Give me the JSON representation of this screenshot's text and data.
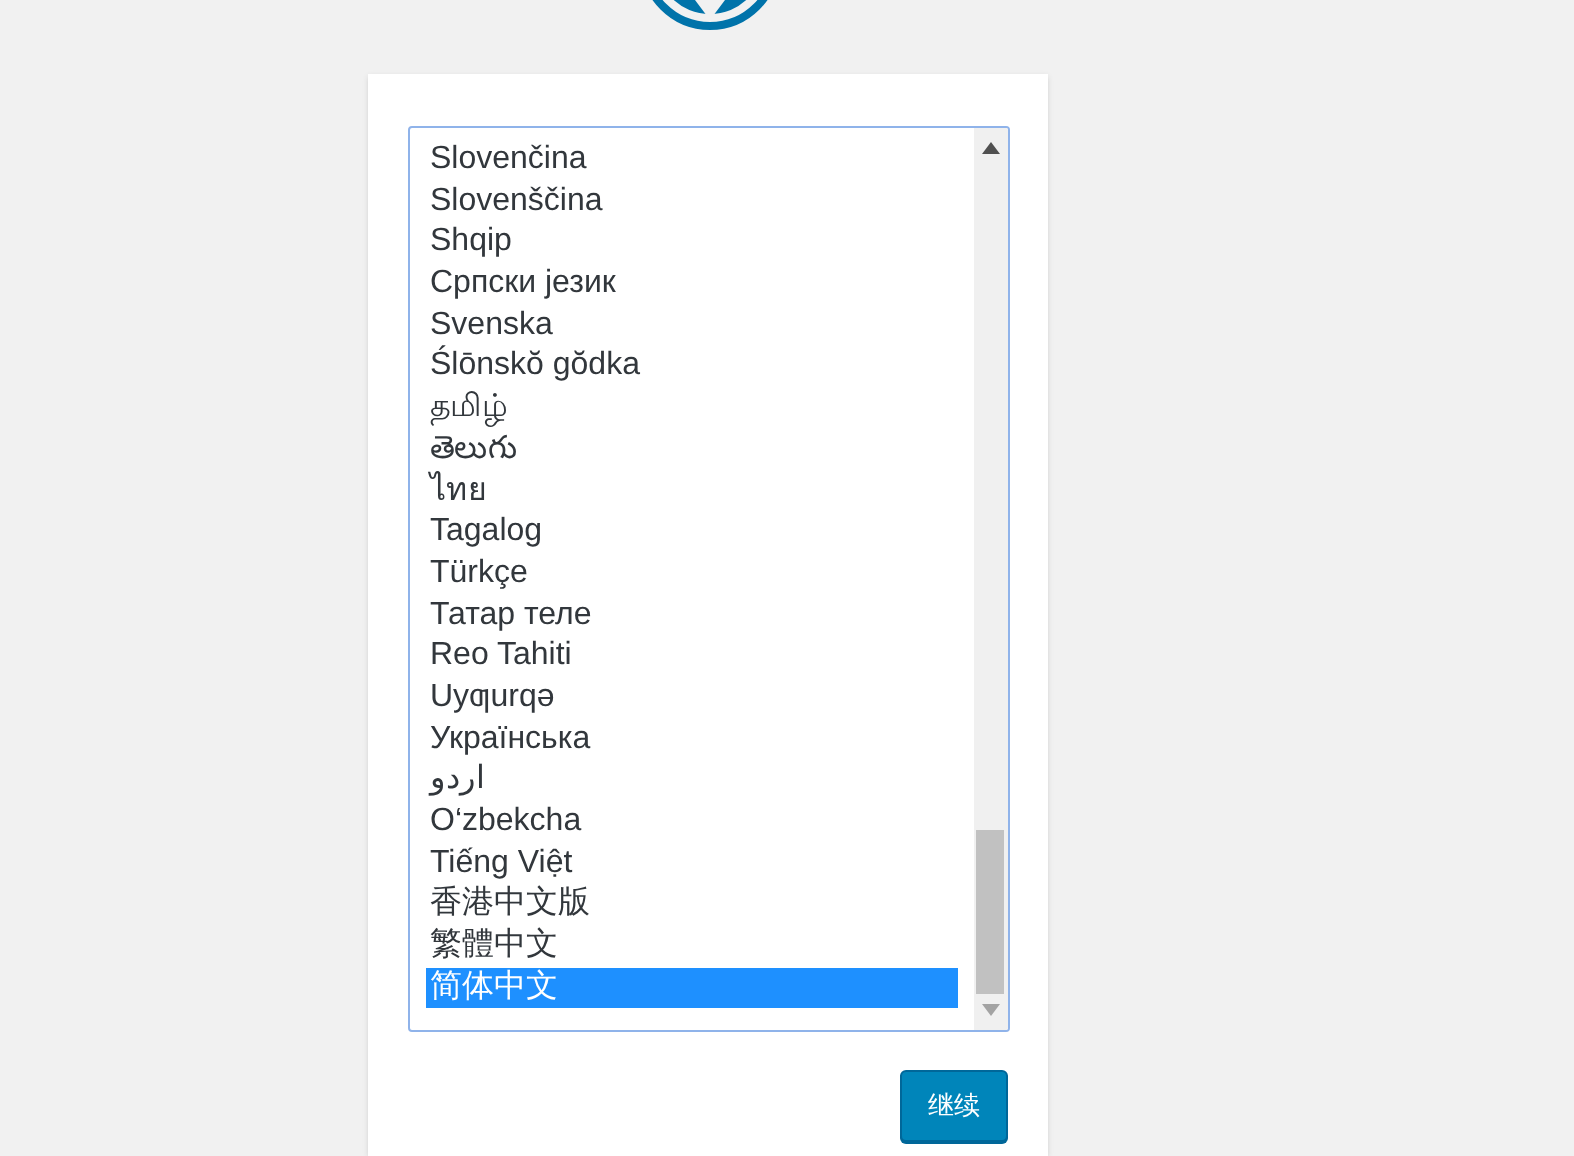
{
  "language_list": {
    "items": [
      {
        "label": "Slovenčina",
        "selected": false
      },
      {
        "label": "Slovenščina",
        "selected": false
      },
      {
        "label": "Shqip",
        "selected": false
      },
      {
        "label": "Српски језик",
        "selected": false
      },
      {
        "label": "Svenska",
        "selected": false
      },
      {
        "label": "Ślōnskŏ gŏdka",
        "selected": false
      },
      {
        "label": "தமிழ்",
        "selected": false
      },
      {
        "label": "తెలుగు",
        "selected": false
      },
      {
        "label": "ไทย",
        "selected": false
      },
      {
        "label": "Tagalog",
        "selected": false
      },
      {
        "label": "Türkçe",
        "selected": false
      },
      {
        "label": "Татар теле",
        "selected": false
      },
      {
        "label": "Reo Tahiti",
        "selected": false
      },
      {
        "label": "Uyƣurqə",
        "selected": false
      },
      {
        "label": "Українська",
        "selected": false
      },
      {
        "label": "اردو",
        "selected": false
      },
      {
        "label": "O‘zbekcha",
        "selected": false
      },
      {
        "label": "Tiếng Việt",
        "selected": false
      },
      {
        "label": "香港中文版",
        "selected": false
      },
      {
        "label": "繁體中文",
        "selected": false
      },
      {
        "label": "简体中文",
        "selected": true
      }
    ]
  },
  "continue_button": {
    "label": "继续"
  }
}
